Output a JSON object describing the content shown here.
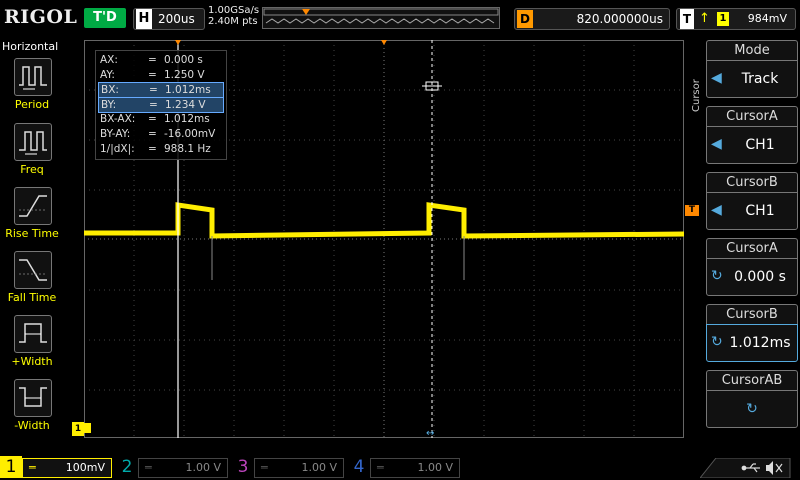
{
  "top": {
    "logo": "RIGOL",
    "run_state": "T'D",
    "horizontal_key": "H",
    "timebase": "200us",
    "sample_rate": "1.00GSa/s",
    "mem_points": "2.40M pts",
    "delay_key": "D",
    "delay_value": "820.000000us",
    "trigger_key": "T",
    "trigger_channel": "1",
    "trigger_level": "984mV"
  },
  "left_panel": {
    "title": "Horizontal",
    "items": [
      {
        "label": "Period",
        "icon": "period-icon"
      },
      {
        "label": "Freq",
        "icon": "freq-icon"
      },
      {
        "label": "Rise Time",
        "icon": "rise-time-icon"
      },
      {
        "label": "Fall Time",
        "icon": "fall-time-icon"
      },
      {
        "label": "+Width",
        "icon": "positive-width-icon"
      },
      {
        "label": "-Width",
        "icon": "negative-width-icon"
      }
    ]
  },
  "cursor_info": {
    "rows": [
      {
        "name": "AX:",
        "value": "0.000 s"
      },
      {
        "name": "AY:",
        "value": "1.250 V"
      },
      {
        "name": "BX:",
        "value": "1.012ms"
      },
      {
        "name": "BY:",
        "value": "1.234 V"
      },
      {
        "name": "BX-AX:",
        "value": "1.012ms"
      },
      {
        "name": "BY-AY:",
        "value": "-16.00mV"
      },
      {
        "name": "1/|dX|:",
        "value": "988.1 Hz"
      }
    ]
  },
  "right_menu": {
    "vertical_label": "Cursor",
    "items": [
      {
        "title": "Mode",
        "value": "Track"
      },
      {
        "title": "CursorA",
        "value": "CH1"
      },
      {
        "title": "CursorB",
        "value": "CH1"
      },
      {
        "title": "CursorA",
        "value": "0.000 s"
      },
      {
        "title": "CursorB",
        "value": "1.012ms"
      },
      {
        "title": "CursorAB",
        "value": ""
      }
    ]
  },
  "channels": [
    {
      "num": "1",
      "scale": "100mV",
      "color": "#ffee00",
      "active": true
    },
    {
      "num": "2",
      "scale": "1.00 V",
      "color": "#00c0c0",
      "active": false
    },
    {
      "num": "3",
      "scale": "1.00 V",
      "color": "#d040d0",
      "active": false
    },
    {
      "num": "4",
      "scale": "1.00 V",
      "color": "#3080ff",
      "active": false
    }
  ],
  "colors": {
    "trace": "#ffee00",
    "trigger_marker": "#ff8800",
    "cursor_line": "#ffffff",
    "selected_row": "#224466"
  }
}
